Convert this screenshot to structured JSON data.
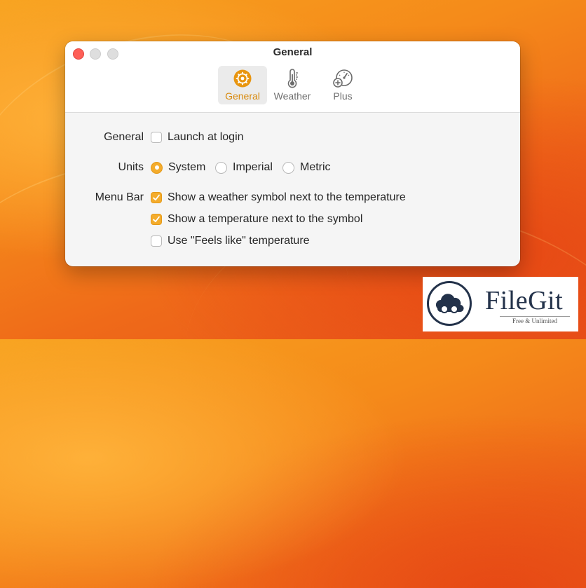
{
  "window": {
    "title": "General",
    "tabs": [
      {
        "id": "general",
        "label": "General",
        "icon": "gear-icon",
        "active": true
      },
      {
        "id": "weather",
        "label": "Weather",
        "icon": "thermometer-icon",
        "active": false
      },
      {
        "id": "plus",
        "label": "Plus",
        "icon": "gauge-plus-icon",
        "active": false
      }
    ]
  },
  "settings": {
    "general": {
      "label": "General",
      "launch_at_login": {
        "label": "Launch at login",
        "checked": false
      }
    },
    "units": {
      "label": "Units",
      "options": [
        {
          "label": "System",
          "selected": true
        },
        {
          "label": "Imperial",
          "selected": false
        },
        {
          "label": "Metric",
          "selected": false
        }
      ]
    },
    "menu_bar": {
      "label": "Menu Bar",
      "options": [
        {
          "label": "Show a weather symbol next to the temperature",
          "checked": true
        },
        {
          "label": "Show a temperature next to the symbol",
          "checked": true
        },
        {
          "label": "Use \"Feels like\" temperature",
          "checked": false
        }
      ]
    }
  },
  "watermark": {
    "name": "FileGit",
    "tagline": "Free & Unlimited"
  },
  "colors": {
    "accent": "#f4ac2c",
    "accent_text": "#d88a0d",
    "close": "#fe5f57"
  }
}
